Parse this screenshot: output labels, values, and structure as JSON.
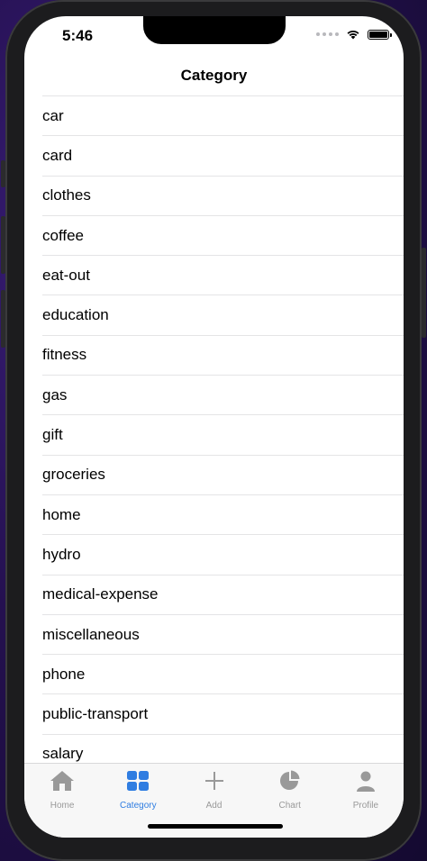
{
  "status_bar": {
    "time": "5:46"
  },
  "nav": {
    "title": "Category"
  },
  "categories": [
    "car",
    "card",
    "clothes",
    "coffee",
    "eat-out",
    "education",
    "fitness",
    "gas",
    "gift",
    "groceries",
    "home",
    "hydro",
    "medical-expense",
    "miscellaneous",
    "phone",
    "public-transport",
    "salary"
  ],
  "tabs": [
    {
      "label": "Home",
      "icon": "house-icon",
      "active": false
    },
    {
      "label": "Category",
      "icon": "grid-icon",
      "active": true
    },
    {
      "label": "Add",
      "icon": "plus-icon",
      "active": false
    },
    {
      "label": "Chart",
      "icon": "pie-chart-icon",
      "active": false
    },
    {
      "label": "Profile",
      "icon": "person-icon",
      "active": false
    }
  ],
  "colors": {
    "accent": "#2f7de1",
    "inactive": "#999999"
  }
}
